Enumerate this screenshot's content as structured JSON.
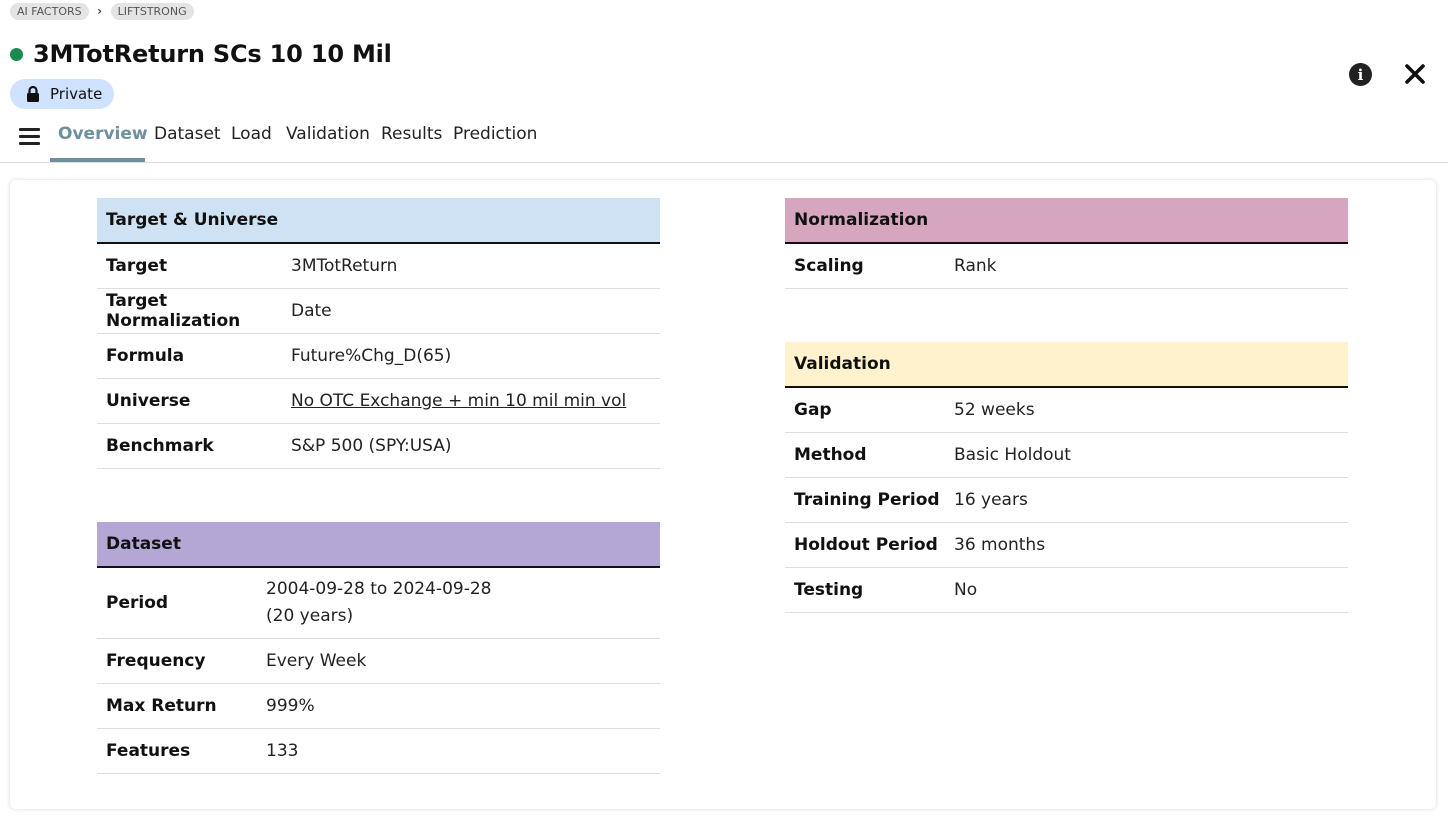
{
  "breadcrumb": {
    "items": [
      "AI FACTORS",
      "LIFTSTRONG"
    ]
  },
  "header": {
    "title": "3MTotReturn SCs 10 10 Mil",
    "status_color": "#1a8a4f",
    "visibility_label": "Private"
  },
  "tabs": [
    "Overview",
    "Dataset",
    "Load",
    "Validation",
    "Results",
    "Prediction"
  ],
  "active_tab": "Overview",
  "sections": {
    "target_universe": {
      "title": "Target & Universe",
      "header_color": "#cfe2f3",
      "rows": [
        {
          "label": "Target",
          "value": "3MTotReturn"
        },
        {
          "label": "Target Normalization",
          "value": "Date"
        },
        {
          "label": "Formula",
          "value": "Future%Chg_D(65)"
        },
        {
          "label": "Universe",
          "value": "No OTC Exchange + min 10 mil min vol"
        },
        {
          "label": "Benchmark",
          "value": "S&P 500 (SPY:USA)"
        }
      ]
    },
    "dataset": {
      "title": "Dataset",
      "header_color": "#b4a7d6",
      "rows": [
        {
          "label": "Period",
          "value": "2004-09-28 to 2024-09-28",
          "value2": "(20 years)"
        },
        {
          "label": "Frequency",
          "value": "Every Week"
        },
        {
          "label": "Max Return",
          "value": "999%"
        },
        {
          "label": "Features",
          "value": "133"
        }
      ]
    },
    "normalization": {
      "title": "Normalization",
      "header_color": "#d5a6bd",
      "rows": [
        {
          "label": "Scaling",
          "value": "Rank"
        }
      ]
    },
    "validation": {
      "title": "Validation",
      "header_color": "#fff2cc",
      "rows": [
        {
          "label": "Gap",
          "value": "52 weeks"
        },
        {
          "label": "Method",
          "value": "Basic Holdout"
        },
        {
          "label": "Training Period",
          "value": "16 years"
        },
        {
          "label": "Holdout Period",
          "value": "36 months"
        },
        {
          "label": "Testing",
          "value": "No"
        }
      ]
    }
  },
  "icons": {
    "info": "info-circle-icon",
    "close": "close-icon",
    "menu": "hamburger-menu-icon",
    "lock": "lock-icon"
  }
}
